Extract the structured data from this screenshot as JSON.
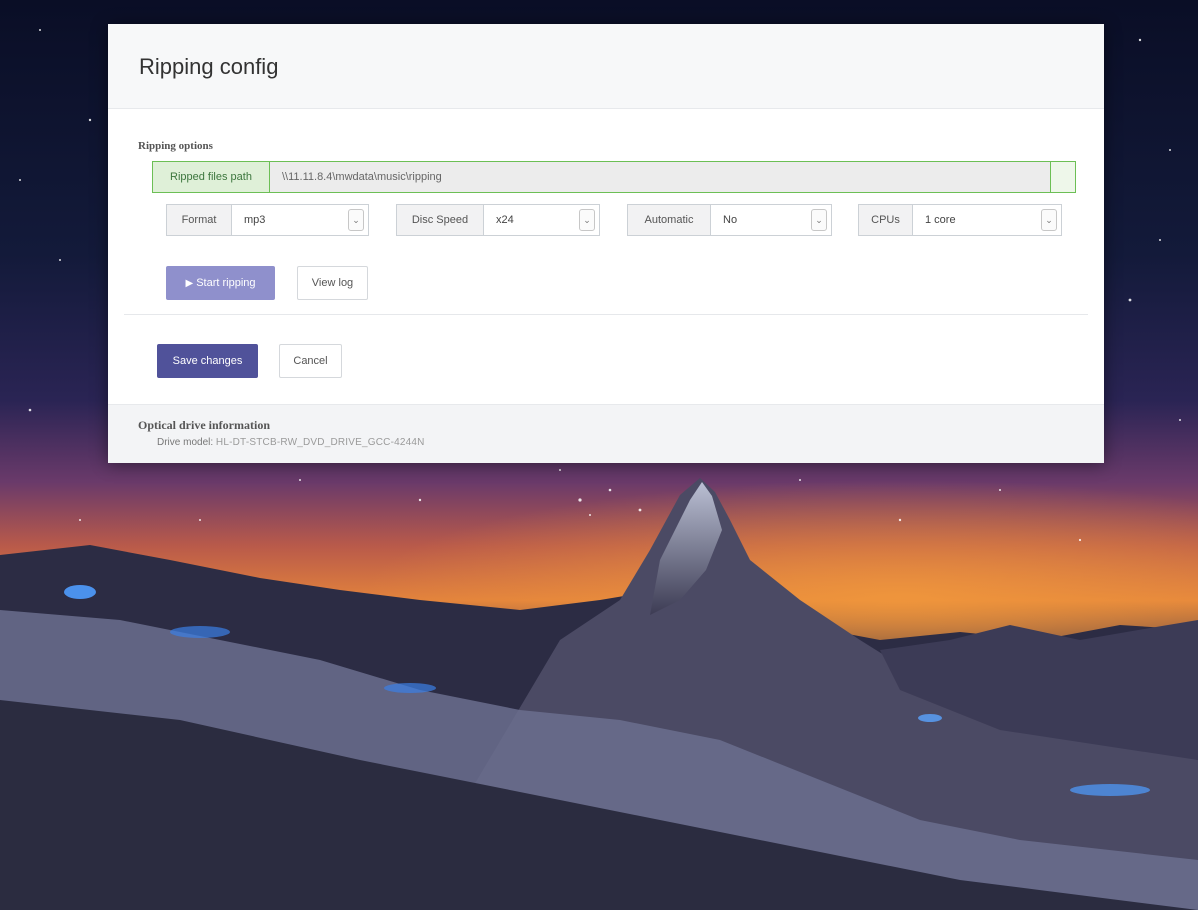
{
  "modal": {
    "title": "Ripping config",
    "section_label": "Ripping options",
    "path": {
      "label": "Ripped files path",
      "value": "\\\\11.11.8.4\\mwdata\\music\\ripping"
    },
    "selects": [
      {
        "label": "Format",
        "value": "mp3"
      },
      {
        "label": "Disc Speed",
        "value": "x24"
      },
      {
        "label": "Automatic",
        "value": "No"
      },
      {
        "label": "CPUs",
        "value": "1 core"
      }
    ],
    "buttons": {
      "start_icon": "play-icon",
      "start_label": "Start ripping",
      "view_log": "View log",
      "save": "Save changes",
      "cancel": "Cancel"
    },
    "footer": {
      "title": "Optical drive information",
      "drive_model_label": "Drive model:",
      "drive_model_value": "HL-DT-STCB-RW_DVD_DRIVE_GCC-4244N"
    }
  },
  "icons": {
    "caret": "chevron-down-icon",
    "start": "play-icon"
  },
  "colors": {
    "primary": "#50529a",
    "primary_disabled": "#8f90cc",
    "success_border": "#6cbf55",
    "success_bg": "#dff0d8"
  }
}
